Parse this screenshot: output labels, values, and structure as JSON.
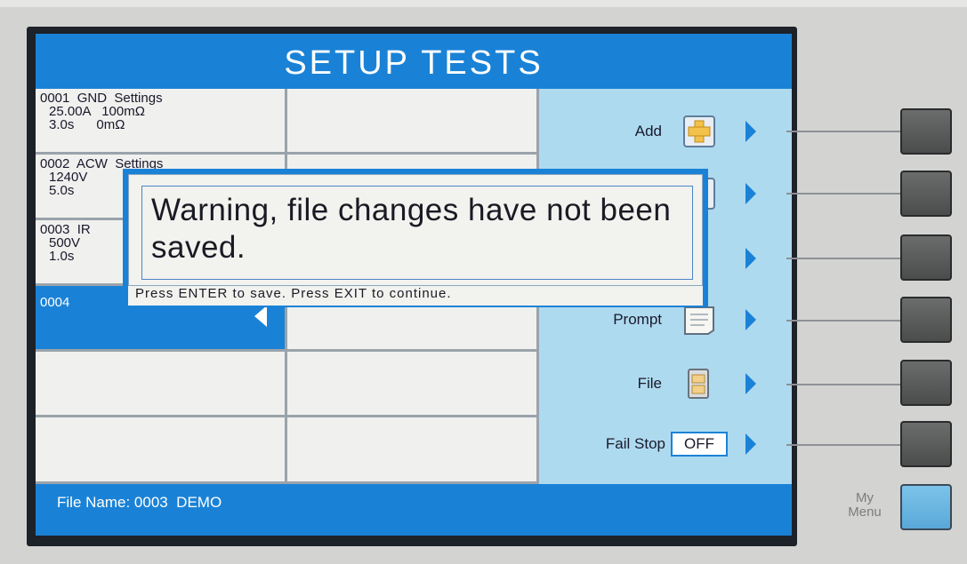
{
  "screen": {
    "title": "SETUP TESTS",
    "status": {
      "file_name_label": "File Name:",
      "file_name_value": "0003  DEMO"
    }
  },
  "tests": [
    {
      "header": "0001  GND  Settings",
      "line2": "25.00A   100mΩ",
      "line3": "3.0s      0mΩ"
    },
    {
      "header": "0002  ACW  Settings",
      "line2": "1240V",
      "line3": "5.0s"
    },
    {
      "header": "0003  IR",
      "line2": "500V",
      "line3": "1.0s"
    },
    {
      "header": "0004",
      "line2": "",
      "line3": ""
    }
  ],
  "menu": [
    {
      "label": "Add",
      "icon": "plus-icon"
    },
    {
      "label": "",
      "icon": "edit-icon"
    },
    {
      "label": "",
      "icon": "connection-icon"
    },
    {
      "label": "Prompt",
      "icon": "document-icon"
    },
    {
      "label": "File",
      "icon": "file-cabinet-icon"
    },
    {
      "label": "Fail Stop",
      "value": "OFF",
      "icon": ""
    }
  ],
  "dialog": {
    "message": "Warning, file changes have not been saved.",
    "hint": "Press ENTER to save.  Press EXIT to continue."
  },
  "hardware": {
    "my_menu_label_1": "My",
    "my_menu_label_2": "Menu"
  },
  "colors": {
    "accent_blue": "#1a82d6",
    "side_panel": "#aedaf0",
    "cell_bg": "#f0f0ee",
    "my_menu_button": "#6bb6e2"
  }
}
